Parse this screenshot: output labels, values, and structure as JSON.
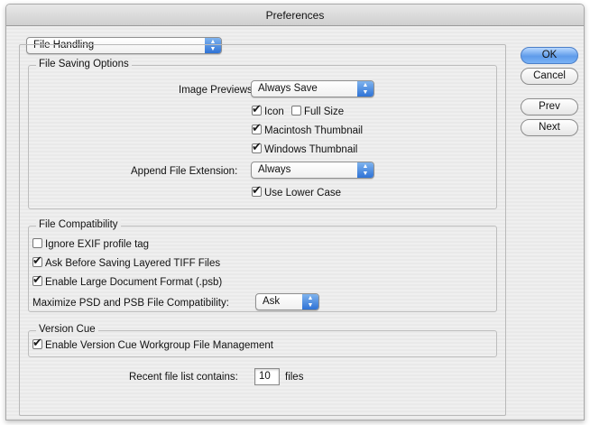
{
  "window": {
    "title": "Preferences"
  },
  "section_selector": {
    "value": "File Handling"
  },
  "buttons": {
    "ok": "OK",
    "cancel": "Cancel",
    "prev": "Prev",
    "next": "Next"
  },
  "file_saving": {
    "group_label": "File Saving Options",
    "image_previews_label": "Image Previews:",
    "image_previews_value": "Always Save",
    "icon_label": "Icon",
    "icon_checked": true,
    "full_size_label": "Full Size",
    "full_size_checked": false,
    "mac_thumb_label": "Macintosh Thumbnail",
    "mac_thumb_checked": true,
    "win_thumb_label": "Windows Thumbnail",
    "win_thumb_checked": true,
    "append_ext_label": "Append File Extension:",
    "append_ext_value": "Always",
    "lower_case_label": "Use Lower Case",
    "lower_case_checked": true
  },
  "file_compat": {
    "group_label": "File Compatibility",
    "ignore_exif_label": "Ignore EXIF profile tag",
    "ignore_exif_checked": false,
    "ask_tiff_label": "Ask Before Saving Layered TIFF Files",
    "ask_tiff_checked": true,
    "large_doc_label": "Enable Large Document Format (.psb)",
    "large_doc_checked": true,
    "maximize_label": "Maximize PSD and PSB File Compatibility:",
    "maximize_value": "Ask"
  },
  "version_cue": {
    "group_label": "Version Cue",
    "enable_label": "Enable Version Cue Workgroup File Management",
    "enable_checked": true
  },
  "recent_files": {
    "label": "Recent file list contains:",
    "value": "10",
    "suffix": "files"
  },
  "icons": {
    "popup_arrows": "updown-arrows-icon",
    "check": "checkmark-icon"
  },
  "colors": {
    "accent": "#3a7ee0",
    "window_bg": "#ececec"
  }
}
